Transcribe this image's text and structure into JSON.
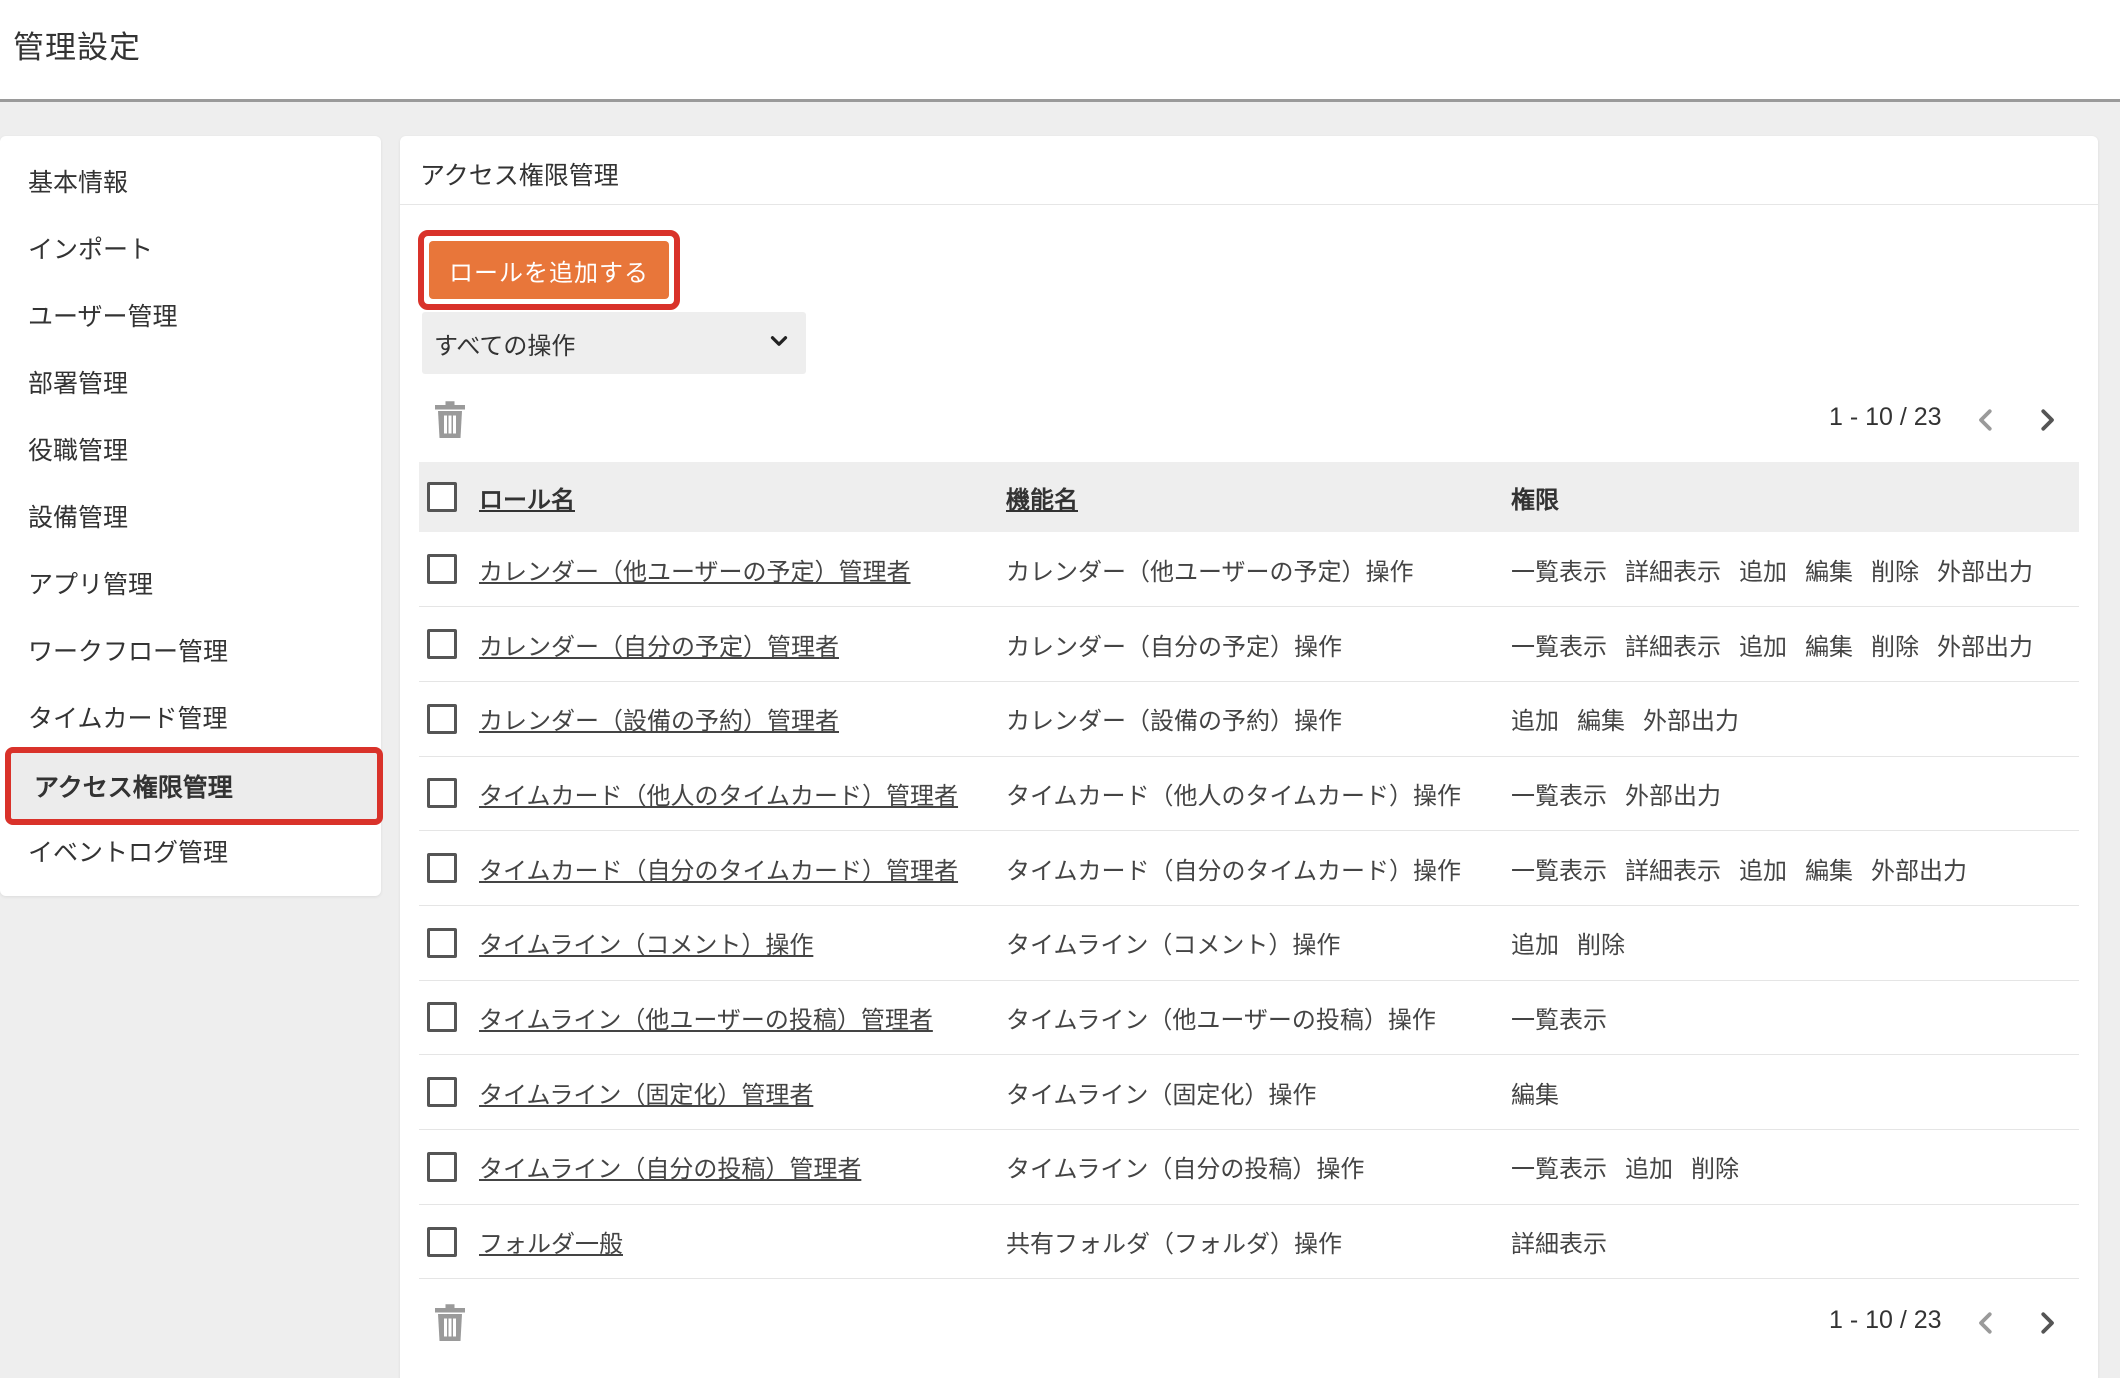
{
  "header": {
    "title": "管理設定"
  },
  "sidebar": {
    "items": [
      {
        "label": "基本情報"
      },
      {
        "label": "インポート"
      },
      {
        "label": "ユーザー管理"
      },
      {
        "label": "部署管理"
      },
      {
        "label": "役職管理"
      },
      {
        "label": "設備管理"
      },
      {
        "label": "アプリ管理"
      },
      {
        "label": "ワークフロー管理"
      },
      {
        "label": "タイムカード管理"
      },
      {
        "label": "アクセス権限管理",
        "active": true
      },
      {
        "label": "イベントログ管理"
      }
    ]
  },
  "main": {
    "title": "アクセス権限管理",
    "add_button": "ロールを追加する",
    "filter": {
      "selected": "すべての操作"
    },
    "pager": {
      "range": "1 - 10 / 23"
    },
    "table": {
      "headers": {
        "role": "ロール名",
        "func": "機能名",
        "perm": "権限"
      },
      "rows": [
        {
          "role": "カレンダー（他ユーザーの予定）管理者",
          "func": "カレンダー（他ユーザーの予定）操作",
          "perms": [
            "一覧表示",
            "詳細表示",
            "追加",
            "編集",
            "削除",
            "外部出力"
          ]
        },
        {
          "role": "カレンダー（自分の予定）管理者",
          "func": "カレンダー（自分の予定）操作",
          "perms": [
            "一覧表示",
            "詳細表示",
            "追加",
            "編集",
            "削除",
            "外部出力"
          ]
        },
        {
          "role": "カレンダー（設備の予約）管理者",
          "func": "カレンダー（設備の予約）操作",
          "perms": [
            "追加",
            "編集",
            "外部出力"
          ]
        },
        {
          "role": "タイムカード（他人のタイムカード）管理者",
          "func": "タイムカード（他人のタイムカード）操作",
          "perms": [
            "一覧表示",
            "外部出力"
          ]
        },
        {
          "role": "タイムカード（自分のタイムカード）管理者",
          "func": "タイムカード（自分のタイムカード）操作",
          "perms": [
            "一覧表示",
            "詳細表示",
            "追加",
            "編集",
            "外部出力"
          ]
        },
        {
          "role": "タイムライン（コメント）操作",
          "func": "タイムライン（コメント）操作",
          "perms": [
            "追加",
            "削除"
          ]
        },
        {
          "role": "タイムライン（他ユーザーの投稿）管理者",
          "func": "タイムライン（他ユーザーの投稿）操作",
          "perms": [
            "一覧表示"
          ]
        },
        {
          "role": "タイムライン（固定化）管理者",
          "func": "タイムライン（固定化）操作",
          "perms": [
            "編集"
          ]
        },
        {
          "role": "タイムライン（自分の投稿）管理者",
          "func": "タイムライン（自分の投稿）操作",
          "perms": [
            "一覧表示",
            "追加",
            "削除"
          ]
        },
        {
          "role": "フォルダ一般",
          "func": "共有フォルダ（フォルダ）操作",
          "perms": [
            "詳細表示"
          ]
        }
      ]
    }
  },
  "icons": {
    "trash": "trash-icon",
    "prev": "chevron-left-icon",
    "next": "chevron-right-icon",
    "dropdown": "chevron-down-icon"
  },
  "colors": {
    "accent": "#e8763a",
    "highlight": "#d9322a"
  }
}
